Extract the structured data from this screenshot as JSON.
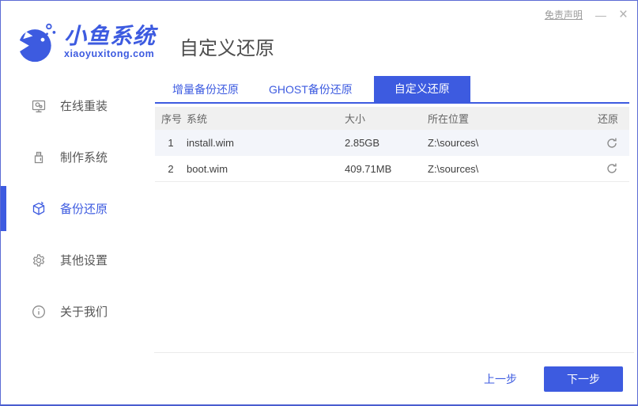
{
  "window": {
    "disclaimer": "免责声明",
    "minimize_label": "—",
    "close_label": "×"
  },
  "brand": {
    "name": "小鱼系统",
    "domain": "xiaoyuxitong.com"
  },
  "header": {
    "title": "自定义还原"
  },
  "sidebar": {
    "items": [
      {
        "label": "在线重装",
        "icon": "monitor-icon",
        "active": false
      },
      {
        "label": "制作系统",
        "icon": "usb-drive-icon",
        "active": false
      },
      {
        "label": "备份还原",
        "icon": "backup-cube-icon",
        "active": true
      },
      {
        "label": "其他设置",
        "icon": "gear-icon",
        "active": false
      },
      {
        "label": "关于我们",
        "icon": "info-icon",
        "active": false
      }
    ]
  },
  "tabs": [
    {
      "label": "增量备份还原",
      "active": false
    },
    {
      "label": "GHOST备份还原",
      "active": false
    },
    {
      "label": "自定义还原",
      "active": true
    }
  ],
  "table": {
    "columns": [
      "序号",
      "系统",
      "大小",
      "所在位置",
      "还原"
    ],
    "rows": [
      {
        "index": "1",
        "system": "install.wim",
        "size": "2.85GB",
        "location": "Z:\\sources\\"
      },
      {
        "index": "2",
        "system": "boot.wim",
        "size": "409.71MB",
        "location": "Z:\\sources\\"
      }
    ]
  },
  "footer": {
    "prev_label": "上一步",
    "next_label": "下一步"
  },
  "colors": {
    "accent": "#3d5be0",
    "table_header_bg": "#f0f0f0",
    "row_highlight_bg": "#f3f5fa"
  }
}
